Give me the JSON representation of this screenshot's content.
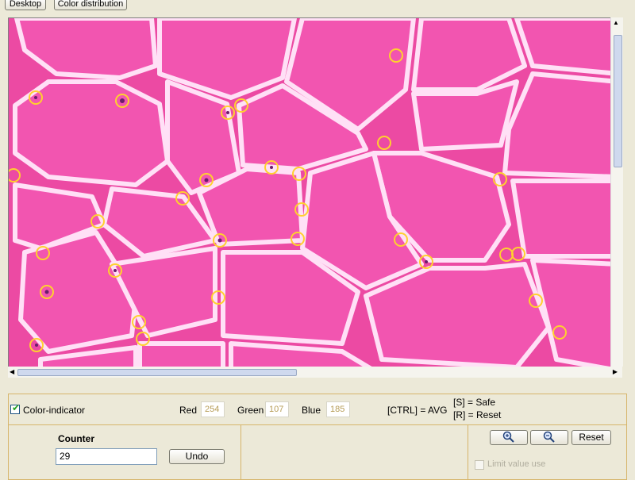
{
  "toolbar": {
    "desktop_label": "Desktop",
    "color_distribution_label": "Color distribution"
  },
  "viewer": {
    "marker_color": "#ffd12e",
    "tissue_color": "#f04fa8",
    "membrane_color": "#ffd6f4"
  },
  "controls": {
    "color_indicator_label": "Color-indicator",
    "color_indicator_checked": true,
    "red_label": "Red",
    "red_value": "254",
    "green_label": "Green",
    "green_value": "107",
    "blue_label": "Blue",
    "blue_value": "185",
    "ctrl_hint": "[CTRL] = AVG",
    "safe_hint": "[S] = Safe",
    "reset_hint": "[R] = Reset"
  },
  "counter": {
    "title": "Counter",
    "value": "29",
    "undo_label": "Undo"
  },
  "zoom": {
    "zoom_in_icon": "zoom-in-icon",
    "zoom_out_icon": "zoom-out-icon",
    "reset_label": "Reset",
    "limit_label": "Limit value use"
  }
}
